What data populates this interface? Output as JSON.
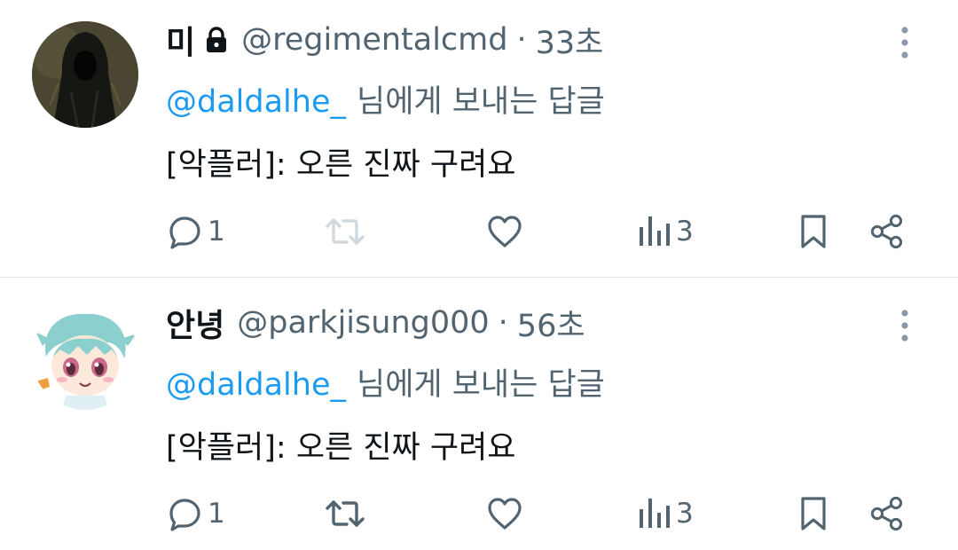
{
  "tweets": [
    {
      "display_name": "미",
      "protected": true,
      "handle": "@regimentalcmd",
      "separator": "·",
      "time": "33초",
      "reply_to_mention": "@daldalhe_",
      "reply_to_suffix": "님에게 보내는 답글",
      "text": "[악플러]: 오른 진짜 구려요",
      "reply_count": "1",
      "views_count": "3",
      "avatar_icon": "hooded-figure-avatar",
      "retweet_color": "#cfd9de"
    },
    {
      "display_name": "안녕",
      "protected": false,
      "handle": "@parkjisung000",
      "separator": "·",
      "time": "56초",
      "reply_to_mention": "@daldalhe_",
      "reply_to_suffix": "님에게 보내는 답글",
      "text": "[악플러]: 오른 진짜 구려요",
      "reply_count": "1",
      "views_count": "3",
      "avatar_icon": "anime-character-avatar",
      "retweet_color": "#536471"
    }
  ],
  "colors": {
    "text": "#0f1419",
    "secondary": "#536471",
    "link": "#1d9bf0",
    "divider": "#e3e7ea"
  }
}
